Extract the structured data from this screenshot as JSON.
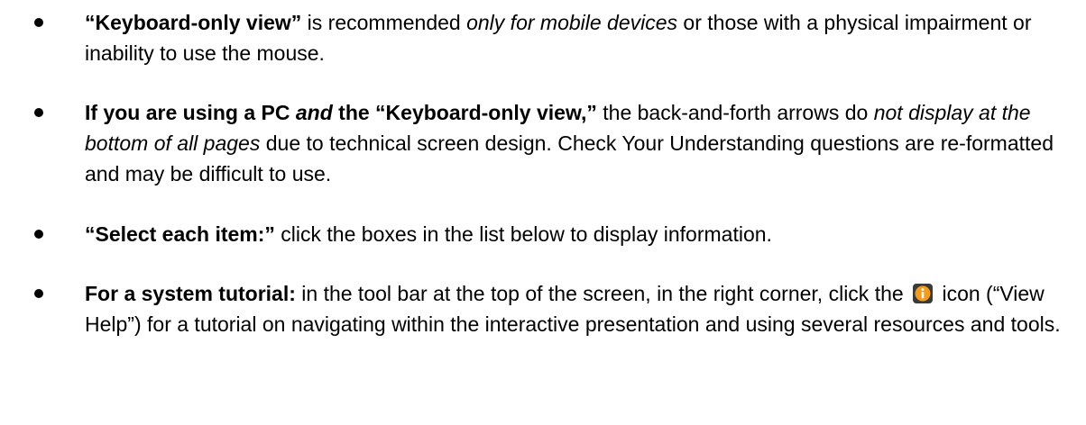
{
  "bullets": [
    {
      "segments": [
        {
          "style": "b",
          "text": "“Keyboard-only view”"
        },
        {
          "style": "",
          "text": " is recommended "
        },
        {
          "style": "i",
          "text": "only for mobile devices"
        },
        {
          "style": "",
          "text": " or those with a physical impairment or inability to use the mouse."
        }
      ]
    },
    {
      "segments": [
        {
          "style": "b",
          "text": "If you are using a PC "
        },
        {
          "style": "bi",
          "text": "and"
        },
        {
          "style": "b",
          "text": " the “Keyboard-only view,”"
        },
        {
          "style": "",
          "text": " the back-and-forth arrows do "
        },
        {
          "style": "i",
          "text": "not display at the bottom of all pages"
        },
        {
          "style": "",
          "text": " due to technical screen design. Check Your Understanding questions are re-formatted and may be difficult to use."
        }
      ]
    },
    {
      "segments": [
        {
          "style": "b",
          "text": "“Select each item:”"
        },
        {
          "style": "",
          "text": " click the boxes in the list below to display information."
        }
      ]
    },
    {
      "segments": [
        {
          "style": "b",
          "text": "For a system tutorial:"
        },
        {
          "style": "",
          "text": " in the tool bar at the top of the screen, in the right corner, click the "
        },
        {
          "style": "icon",
          "icon": "info-icon"
        },
        {
          "style": "",
          "text": " icon (“View Help”) for a tutorial on navigating within the interactive presentation and using several resources and tools."
        }
      ]
    }
  ],
  "colors": {
    "text": "#000000",
    "icon_bg": "#3a3a3a",
    "icon_circle": "#f59c1a"
  }
}
